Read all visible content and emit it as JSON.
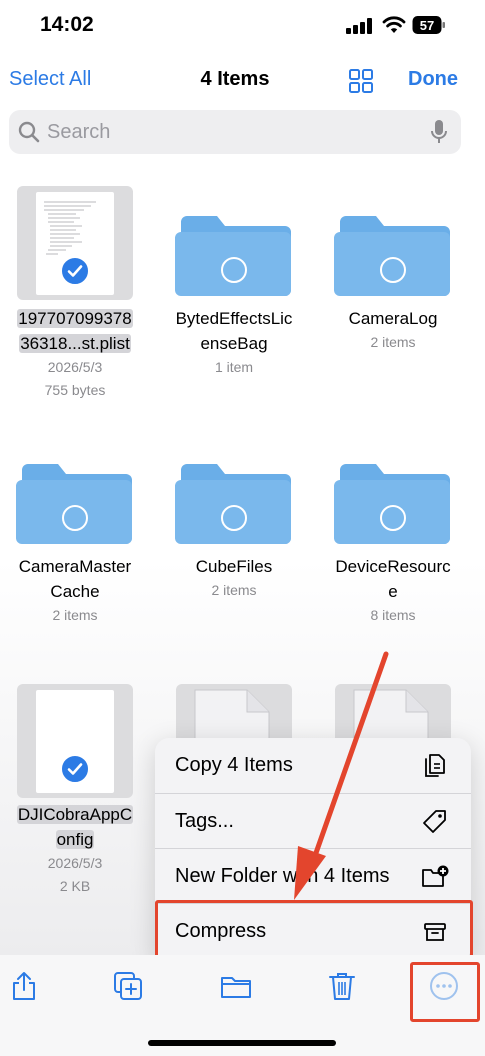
{
  "status_bar": {
    "time": "14:02",
    "battery": "57"
  },
  "nav": {
    "select_all": "Select All",
    "title": "4 Items",
    "done": "Done",
    "grid_icon": "grid-icon"
  },
  "search": {
    "placeholder": "Search",
    "value": ""
  },
  "items": [
    {
      "name": "197707099378\n36318...st.plist",
      "meta1": "2026/5/3",
      "meta2": "755 bytes",
      "kind": "file",
      "selected": true
    },
    {
      "name": "BytedEffectsLic\nenseBag",
      "meta1": "1 item",
      "meta2": "",
      "kind": "folder",
      "selected": false
    },
    {
      "name": "CameraLog",
      "meta1": "2 items",
      "meta2": "",
      "kind": "folder",
      "selected": false
    },
    {
      "name": "CameraMaster\nCache",
      "meta1": "2 items",
      "meta2": "",
      "kind": "folder",
      "selected": false
    },
    {
      "name": "CubeFiles",
      "meta1": "2 items",
      "meta2": "",
      "kind": "folder",
      "selected": false
    },
    {
      "name": "DeviceResourc\ne",
      "meta1": "8 items",
      "meta2": "",
      "kind": "folder",
      "selected": false
    },
    {
      "name": "DJICobraAppC\nonfig",
      "meta1": "2026/5/3",
      "meta2": "2 KB",
      "kind": "file",
      "selected": true
    },
    {
      "name": "",
      "meta1": "",
      "meta2": "",
      "kind": "generic-file",
      "selected": false
    },
    {
      "name": "",
      "meta1": "",
      "meta2": "",
      "kind": "generic-file",
      "selected": false
    }
  ],
  "menu": {
    "items": [
      {
        "label": "Copy 4 Items",
        "icon": "copy-icon"
      },
      {
        "label": "Tags...",
        "icon": "tag-icon"
      },
      {
        "label": "New Folder with 4 Items",
        "icon": "new-folder-icon"
      },
      {
        "label": "Compress",
        "icon": "archive-icon"
      }
    ]
  },
  "toolbar": [
    "share-icon",
    "duplicate-icon",
    "folder-icon",
    "trash-icon",
    "more-icon"
  ],
  "colors": {
    "accent": "#2c7be5",
    "folder": "#6aaee8",
    "annotation": "#e3452d"
  }
}
